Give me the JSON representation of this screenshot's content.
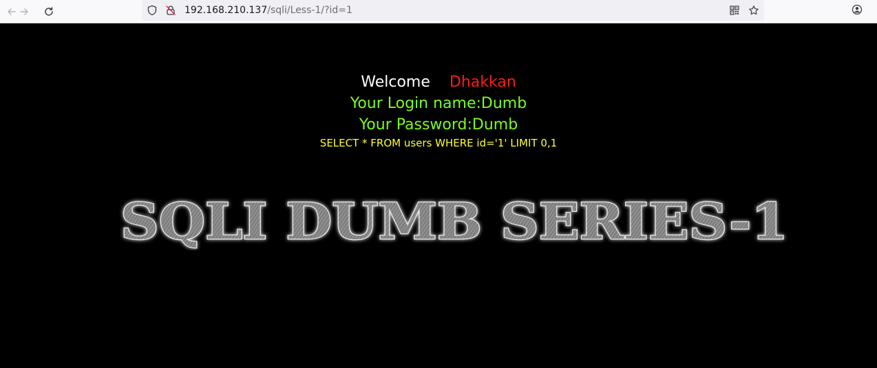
{
  "browser": {
    "url_host": "192.168.210.137",
    "url_path": "/sqli/Less-1/?id=1",
    "icons": {
      "back": "back-arrow-icon",
      "forward": "forward-arrow-icon",
      "reload": "reload-icon",
      "tracking": "shield-icon",
      "insecure": "insecure-lock-icon",
      "qr": "qr-code-icon",
      "bookmark": "star-icon",
      "account": "account-icon"
    }
  },
  "page": {
    "welcome_word": "Welcome",
    "welcome_name": "Dhakkan",
    "login_line": "Your Login name:Dumb",
    "password_line": "Your Password:Dumb",
    "query_line": "SELECT * FROM users WHERE id='1' LIMIT 0,1",
    "logo_text": "SQLI DUMB SERIES-1"
  },
  "colors": {
    "background": "#000000",
    "welcome_word": "#ffffff",
    "welcome_name": "#ff1a1a",
    "credentials": "#7cfc1e",
    "query": "#ffff33"
  }
}
